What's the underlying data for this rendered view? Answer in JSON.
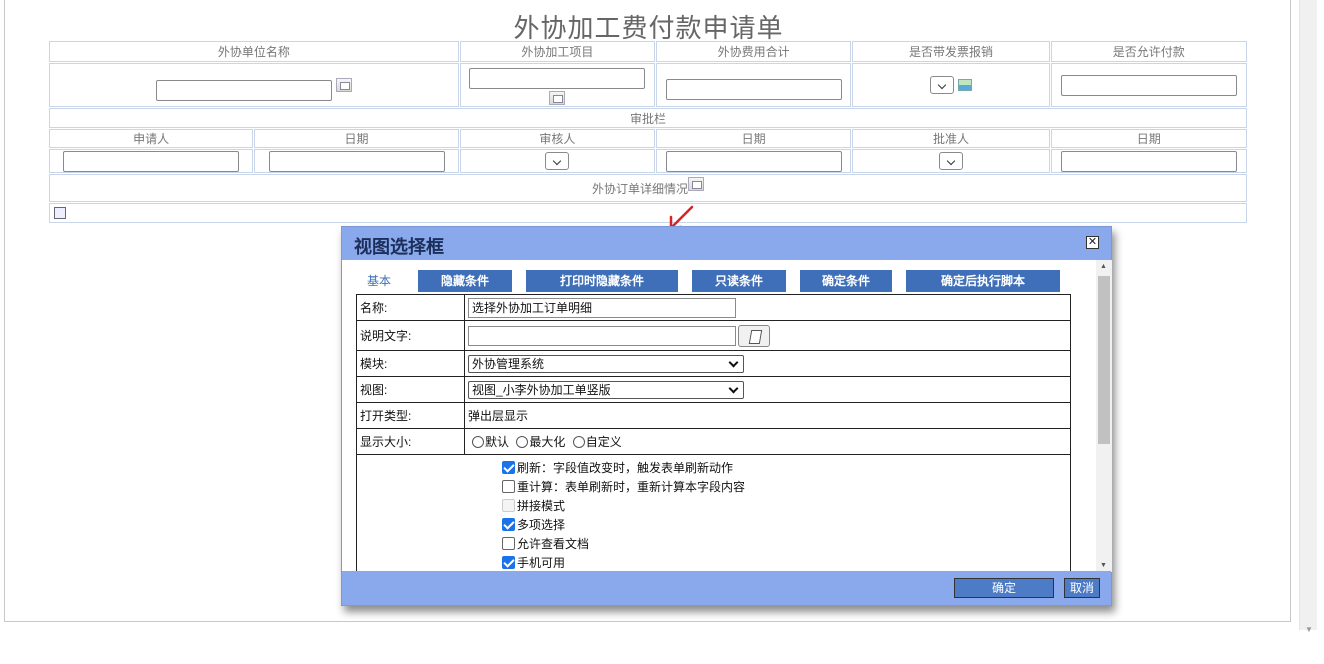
{
  "form": {
    "title": "外协加工费付款申请单",
    "headers": [
      "外协单位名称",
      "外协加工项目",
      "外协费用合计",
      "是否带发票报销",
      "是否允许付款"
    ],
    "approval_section": "审批栏",
    "approval_headers": [
      "申请人",
      "日期",
      "审核人",
      "日期",
      "批准人",
      "日期"
    ],
    "order_detail_label": "外协订单详细情况"
  },
  "dialog": {
    "title": "视图选择框",
    "close": "✕",
    "tabs": [
      "基本",
      "隐藏条件",
      "打印时隐藏条件",
      "只读条件",
      "确定条件",
      "确定后执行脚本"
    ],
    "rows": {
      "name_label": "名称:",
      "name_value": "选择外协加工订单明细",
      "desc_label": "说明文字:",
      "desc_value": "",
      "module_label": "模块:",
      "module_value": "外协管理系统",
      "view_label": "视图:",
      "view_value": "视图_小李外协加工单竖版",
      "open_type_label": "打开类型:",
      "open_type_value": "弹出层显示",
      "size_label": "显示大小:",
      "size_options": [
        "默认",
        "最大化",
        "自定义"
      ]
    },
    "checkboxes": [
      {
        "label": "刷新：字段值改变时，触发表单刷新动作",
        "checked": true
      },
      {
        "label": "重计算：表单刷新时，重新计算本字段内容",
        "checked": false
      },
      {
        "label": "拼接模式",
        "checked": false,
        "disabled": true
      },
      {
        "label": "多项选择",
        "checked": true
      },
      {
        "label": "允许查看文档",
        "checked": false
      },
      {
        "label": "手机可用",
        "checked": true
      }
    ],
    "ok": "确定",
    "cancel": "取消"
  },
  "colors": {
    "dialog_header": "#8aa9ec",
    "tab_bg": "#3f6fb8",
    "annotation_arrow": "#e02020"
  }
}
